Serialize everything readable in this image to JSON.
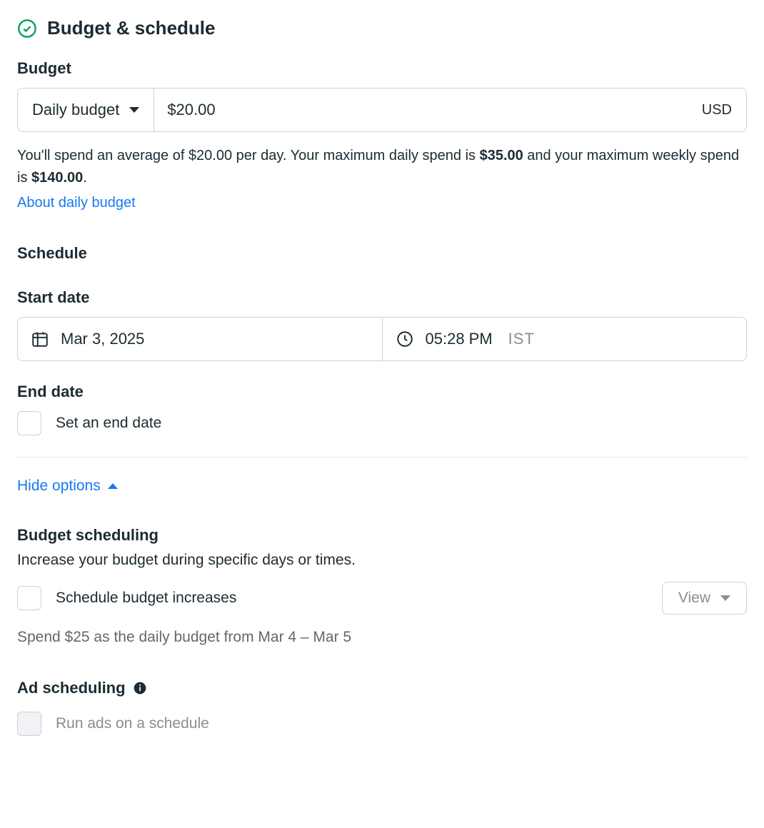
{
  "section": {
    "title": "Budget & schedule"
  },
  "budget": {
    "label": "Budget",
    "type_label": "Daily budget",
    "amount": "$20.00",
    "currency": "USD",
    "helper_prefix": "You'll spend an average of $20.00 per day. Your maximum daily spend is ",
    "helper_max_daily": "$35.00",
    "helper_mid": " and your maximum weekly spend is ",
    "helper_max_weekly": "$140.00",
    "helper_suffix": ".",
    "about_link": "About daily budget"
  },
  "schedule": {
    "label": "Schedule",
    "start_label": "Start date",
    "start_date": "Mar 3, 2025",
    "start_time": "05:28 PM",
    "tz": "IST",
    "end_label": "End date",
    "end_checkbox_label": "Set an end date"
  },
  "options": {
    "toggle_label": "Hide options"
  },
  "budget_scheduling": {
    "label": "Budget scheduling",
    "desc": "Increase your budget during specific days or times.",
    "checkbox_label": "Schedule budget increases",
    "view_button": "View",
    "footnote": "Spend $25 as the daily budget from Mar 4 – Mar 5"
  },
  "ad_scheduling": {
    "label": "Ad scheduling",
    "checkbox_label": "Run ads on a schedule"
  }
}
